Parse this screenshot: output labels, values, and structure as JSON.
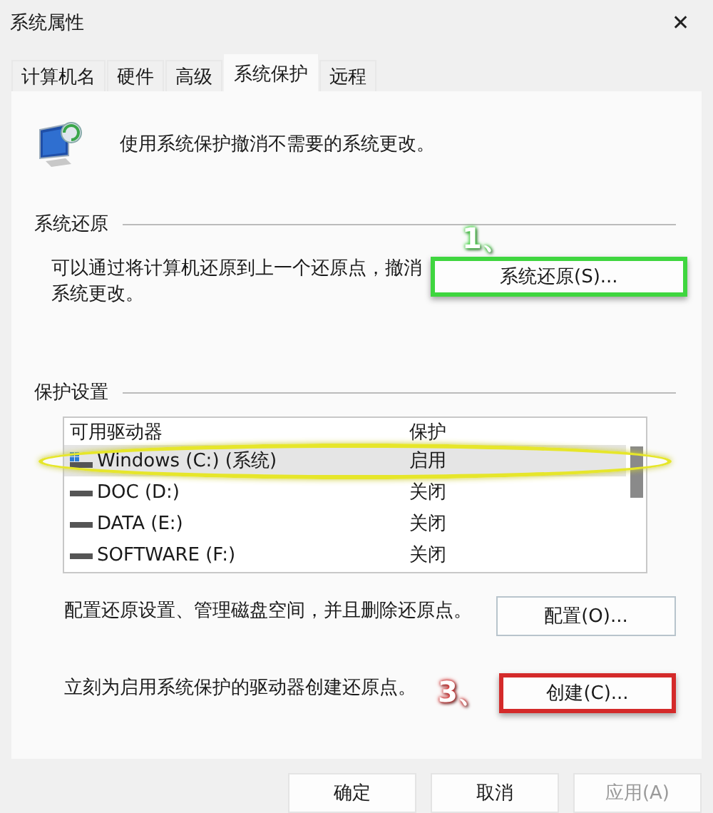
{
  "window": {
    "title": "系统属性",
    "close": "✕"
  },
  "tabs": [
    {
      "label": "计算机名",
      "selected": false
    },
    {
      "label": "硬件",
      "selected": false
    },
    {
      "label": "高级",
      "selected": false
    },
    {
      "label": "系统保护",
      "selected": true
    },
    {
      "label": "远程",
      "selected": false
    }
  ],
  "intro": "使用系统保护撤消不需要的系统更改。",
  "restore": {
    "heading": "系统还原",
    "text": "可以通过将计算机还原到上一个还原点，撤消系统更改。",
    "button": {
      "label": "系统还原(S)...",
      "annotation": {
        "step": "1、",
        "color": "#3fd63f"
      }
    }
  },
  "protection": {
    "heading": "保护设置",
    "columns": [
      "可用驱动器",
      "保护"
    ],
    "drives": [
      {
        "name": "Windows (C:) (系统)",
        "status": "启用",
        "kind": "system",
        "selected": true,
        "circled": true
      },
      {
        "name": "DOC (D:)",
        "status": "关闭",
        "kind": "disk",
        "selected": false,
        "circled": false
      },
      {
        "name": "DATA (E:)",
        "status": "关闭",
        "kind": "disk",
        "selected": false,
        "circled": false
      },
      {
        "name": "SOFTWARE (F:)",
        "status": "关闭",
        "kind": "disk",
        "selected": false,
        "circled": false
      }
    ],
    "configure": {
      "text": "配置还原设置、管理磁盘空间，并且删除还原点。",
      "button": {
        "label": "配置(O)..."
      }
    },
    "create": {
      "text": "立刻为启用系统保护的驱动器创建还原点。",
      "button": {
        "label": "创建(C)...",
        "annotation": {
          "step": "3、",
          "color": "#d42a2a"
        }
      }
    }
  },
  "buttons": [
    {
      "label": "确定",
      "disabled": false
    },
    {
      "label": "取消",
      "disabled": false
    },
    {
      "label": "应用(A)",
      "disabled": true
    }
  ]
}
